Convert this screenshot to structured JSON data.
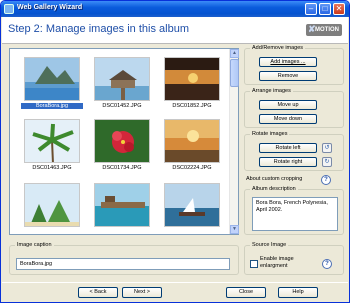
{
  "window": {
    "title": "Web Gallery Wizard"
  },
  "header": {
    "step_title": "Step 2: Manage images in this album",
    "logo_text": "MOTION"
  },
  "images": [
    {
      "caption": "BoraBora.jpg",
      "selected": true
    },
    {
      "caption": "DSC01452.JPG",
      "selected": false
    },
    {
      "caption": "DSC01852.JPG",
      "selected": false
    },
    {
      "caption": "DSC01463.JPG",
      "selected": false
    },
    {
      "caption": "DSC01734.JPG",
      "selected": false
    },
    {
      "caption": "DSC02224.JPG",
      "selected": false
    }
  ],
  "add_remove": {
    "label": "Add/Remove images",
    "add_images": "Add images ...",
    "remove": "Remove"
  },
  "arrange": {
    "label": "Arrange images",
    "move_up": "Move up",
    "move_down": "Move down"
  },
  "rotate": {
    "label": "Rotate images",
    "rotate_left": "Rotate left",
    "rotate_right": "Rotate right"
  },
  "cropping": {
    "label": "About custom cropping"
  },
  "album_description": {
    "label": "Album description",
    "text": "Bora Bora, French Polynesia, April 2002."
  },
  "image_caption": {
    "label": "Image caption",
    "value": "BoraBora.jpg"
  },
  "source_image": {
    "label": "Source Image",
    "enable_enlargement": "Enable image enlargment"
  },
  "footer": {
    "back": "< Back",
    "next": "Next >",
    "close": "Close",
    "help": "Help"
  }
}
